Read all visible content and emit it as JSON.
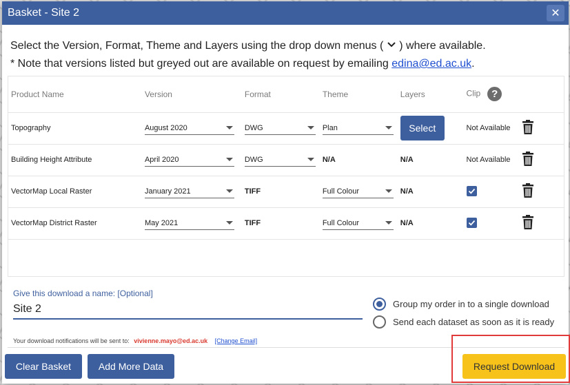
{
  "dialog": {
    "title": "Basket - Site 2",
    "close_glyph": "✕"
  },
  "intro": {
    "line1_before": "Select the Version, Format, Theme and Layers using the drop down menus (",
    "line1_after": ") where available.",
    "line2_before": "* Note that versions listed but greyed out are available on request by emailing",
    "email": "edina@ed.ac.uk",
    "line2_after": "."
  },
  "table": {
    "headers": {
      "product": "Product Name",
      "version": "Version",
      "format": "Format",
      "theme": "Theme",
      "layers": "Layers",
      "clip": "Clip",
      "help_glyph": "?"
    },
    "rows": [
      {
        "product": "Topography",
        "version": "August 2020",
        "format": "DWG",
        "theme": "Plan",
        "layers_button": "Select",
        "clip": "Not Available"
      },
      {
        "product": "Building Height Attribute",
        "version": "April 2020",
        "format": "DWG",
        "theme": "N/A",
        "layers": "N/A",
        "clip": "Not Available"
      },
      {
        "product": "VectorMap Local Raster",
        "version": "January 2021",
        "format": "TIFF",
        "theme": "Full Colour",
        "layers": "N/A",
        "clip_checked": true
      },
      {
        "product": "VectorMap District Raster",
        "version": "May 2021",
        "format": "TIFF",
        "theme": "Full Colour",
        "layers": "N/A",
        "clip_checked": true
      }
    ]
  },
  "download": {
    "name_label": "Give this download a name: [Optional]",
    "name_value": "Site 2",
    "option_single": "Group my order in to a single download",
    "option_each": "Send each dataset as soon as it is ready",
    "selected_option": "single",
    "notify_text": "Your download notifications will be sent to:",
    "notify_email": "vivienne.mayo@ed.ac.uk",
    "change_email": "[Change Email]"
  },
  "footer": {
    "clear_basket": "Clear Basket",
    "add_more": "Add More Data",
    "request_download": "Request Download"
  },
  "colors": {
    "primary": "#3e5f9e",
    "accent": "#f7c31a",
    "highlight": "#e03a3a"
  }
}
